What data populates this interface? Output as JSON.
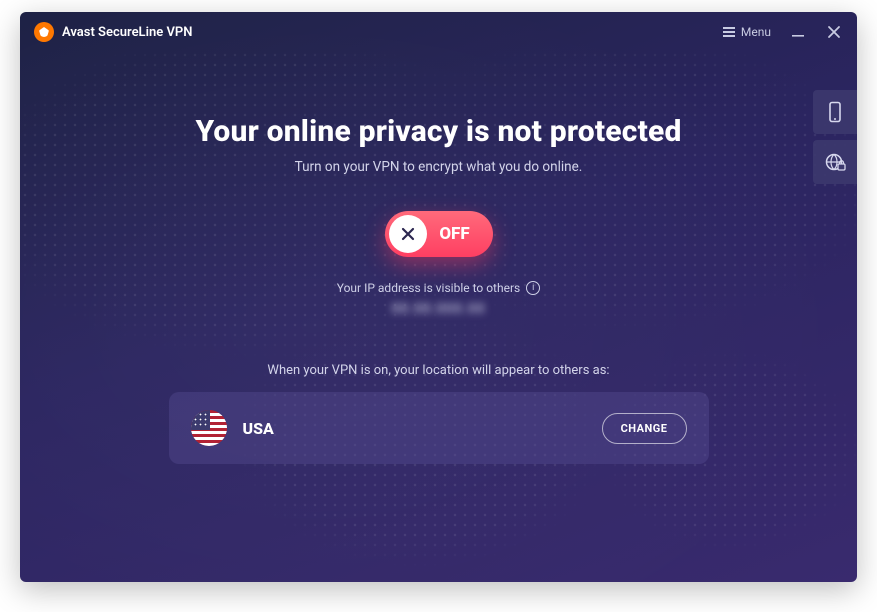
{
  "app": {
    "title": "Avast SecureLine VPN"
  },
  "menu": {
    "label": "Menu"
  },
  "main": {
    "heading": "Your online privacy is not protected",
    "subheading": "Turn on your VPN to encrypt what you do online."
  },
  "toggle": {
    "state_label": "OFF"
  },
  "ip": {
    "label": "Your IP address is visible to others",
    "value_obscured": "88.88.888.88"
  },
  "location": {
    "note": "When your VPN is on, your location will appear to others as:",
    "country": "USA",
    "change_label": "CHANGE"
  }
}
